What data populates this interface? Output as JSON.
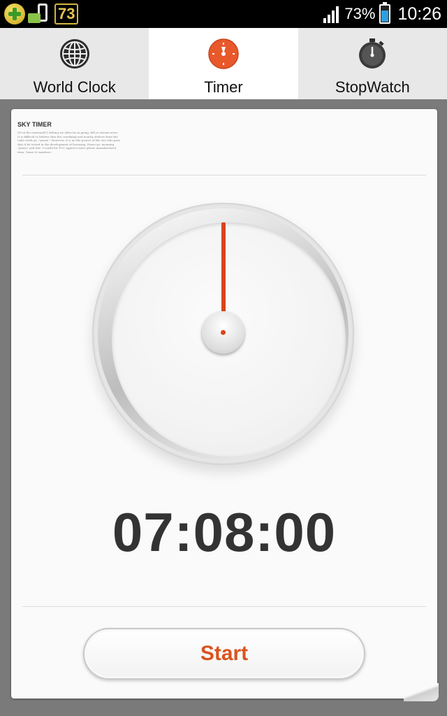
{
  "status_bar": {
    "notification_count": "73",
    "battery_percent": "73%",
    "battery_level": 0.73,
    "time": "10:26",
    "icons": [
      "plus-icon",
      "device-icon",
      "signal-icon",
      "battery-icon"
    ]
  },
  "tabs": [
    {
      "label": "World Clock",
      "icon": "globe-icon",
      "active": false
    },
    {
      "label": "Timer",
      "icon": "timer-icon",
      "active": true
    },
    {
      "label": "StopWatch",
      "icon": "stopwatch-icon",
      "active": false
    }
  ],
  "card": {
    "title": "SKY TIMER",
    "description": "Of on the eastward(?) fishing we often ha in going, hill or stream were. It is difficult to believe that the crucifying and nearby shelves from the Lake week go, \"pause.\" However, it is on the poorer of the one who pass that it be tested in the development of licensing. Pause go, meaning \"pause\" and this \"t-world for FCC approve more phone manufactured item. Game it, numbers"
  },
  "timer": {
    "display": "07:08:00"
  },
  "actions": {
    "start_label": "Start"
  },
  "colors": {
    "accent": "#d9441c",
    "tab_active_bg": "#ffffff",
    "tab_bg": "#e8e8e8",
    "page_bg": "#7a7a7a"
  }
}
